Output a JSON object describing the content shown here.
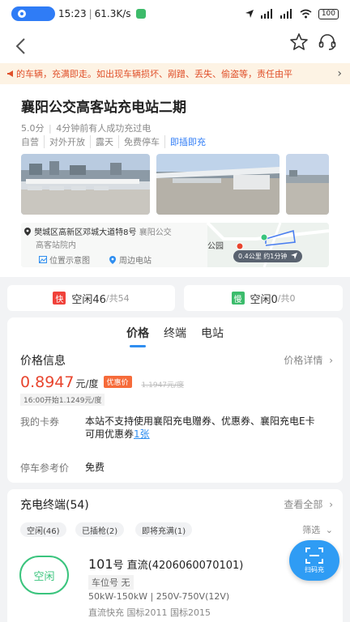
{
  "status_bar": {
    "time": "15:23",
    "network_speed": "61.3K/s",
    "battery": "100"
  },
  "notice": {
    "text": "的车辆，充满即走。如出现车辆损坏、剐蹭、丢失、偷盗等，责任由平"
  },
  "station": {
    "title": "襄阳公交高客站充电站二期",
    "rating": "5.0分",
    "recent": "4分钟前有人成功充过电",
    "tags": [
      "自营",
      "对外开放",
      "露天",
      "免费停车"
    ],
    "plug_tag": "即插即充",
    "address": "樊城区高新区邓城大道特8号",
    "address_suffix": "襄阳公交",
    "address_sub": "高客站院内",
    "map_links": [
      "位置示意图",
      "周边电站"
    ],
    "map_place": "公园",
    "distance": "0.4公里  约1分钟"
  },
  "idle": {
    "fast_badge": "快",
    "fast_label": "空闲46",
    "fast_total": "/共54",
    "slow_badge": "慢",
    "slow_label": "空闲0",
    "slow_total": "/共0"
  },
  "tabs": [
    "价格",
    "终端",
    "电站"
  ],
  "price_info": {
    "title": "价格信息",
    "detail_link": "价格详情",
    "price": "0.8947",
    "unit": "元/度",
    "promo": "优惠价",
    "old_price": "1.1947元/度",
    "time_note": "16:00开始1.1249元/度",
    "coupon_label": "我的卡券",
    "coupon_text_1": "本站不支持使用襄阳充电赠券、优惠券、襄阳充电E卡",
    "coupon_text_2": "可用优惠券",
    "coupon_link": "1张",
    "parking_label": "停车参考价",
    "parking_value": "免费"
  },
  "terminals": {
    "title": "充电终端(54)",
    "view_all": "查看全部",
    "chips": [
      "空闲(46)",
      "已插枪(2)",
      "即将充满(1)"
    ],
    "filter": "筛选",
    "item": {
      "status": "空闲",
      "number": "101",
      "name": "号 直流(4206060070101)",
      "parking": "车位号 无",
      "spec": "50kW-150kW  |  250V-750V(12V)",
      "spec2": "直流快充  国标2011  国标2015"
    }
  },
  "scan_button": "扫码充",
  "colors": {
    "accent": "#2f8ef0",
    "price_red": "#e8452e",
    "idle_green": "#3ac47d",
    "fast_red": "#f0423b",
    "slow_green": "#3cbc6c"
  }
}
